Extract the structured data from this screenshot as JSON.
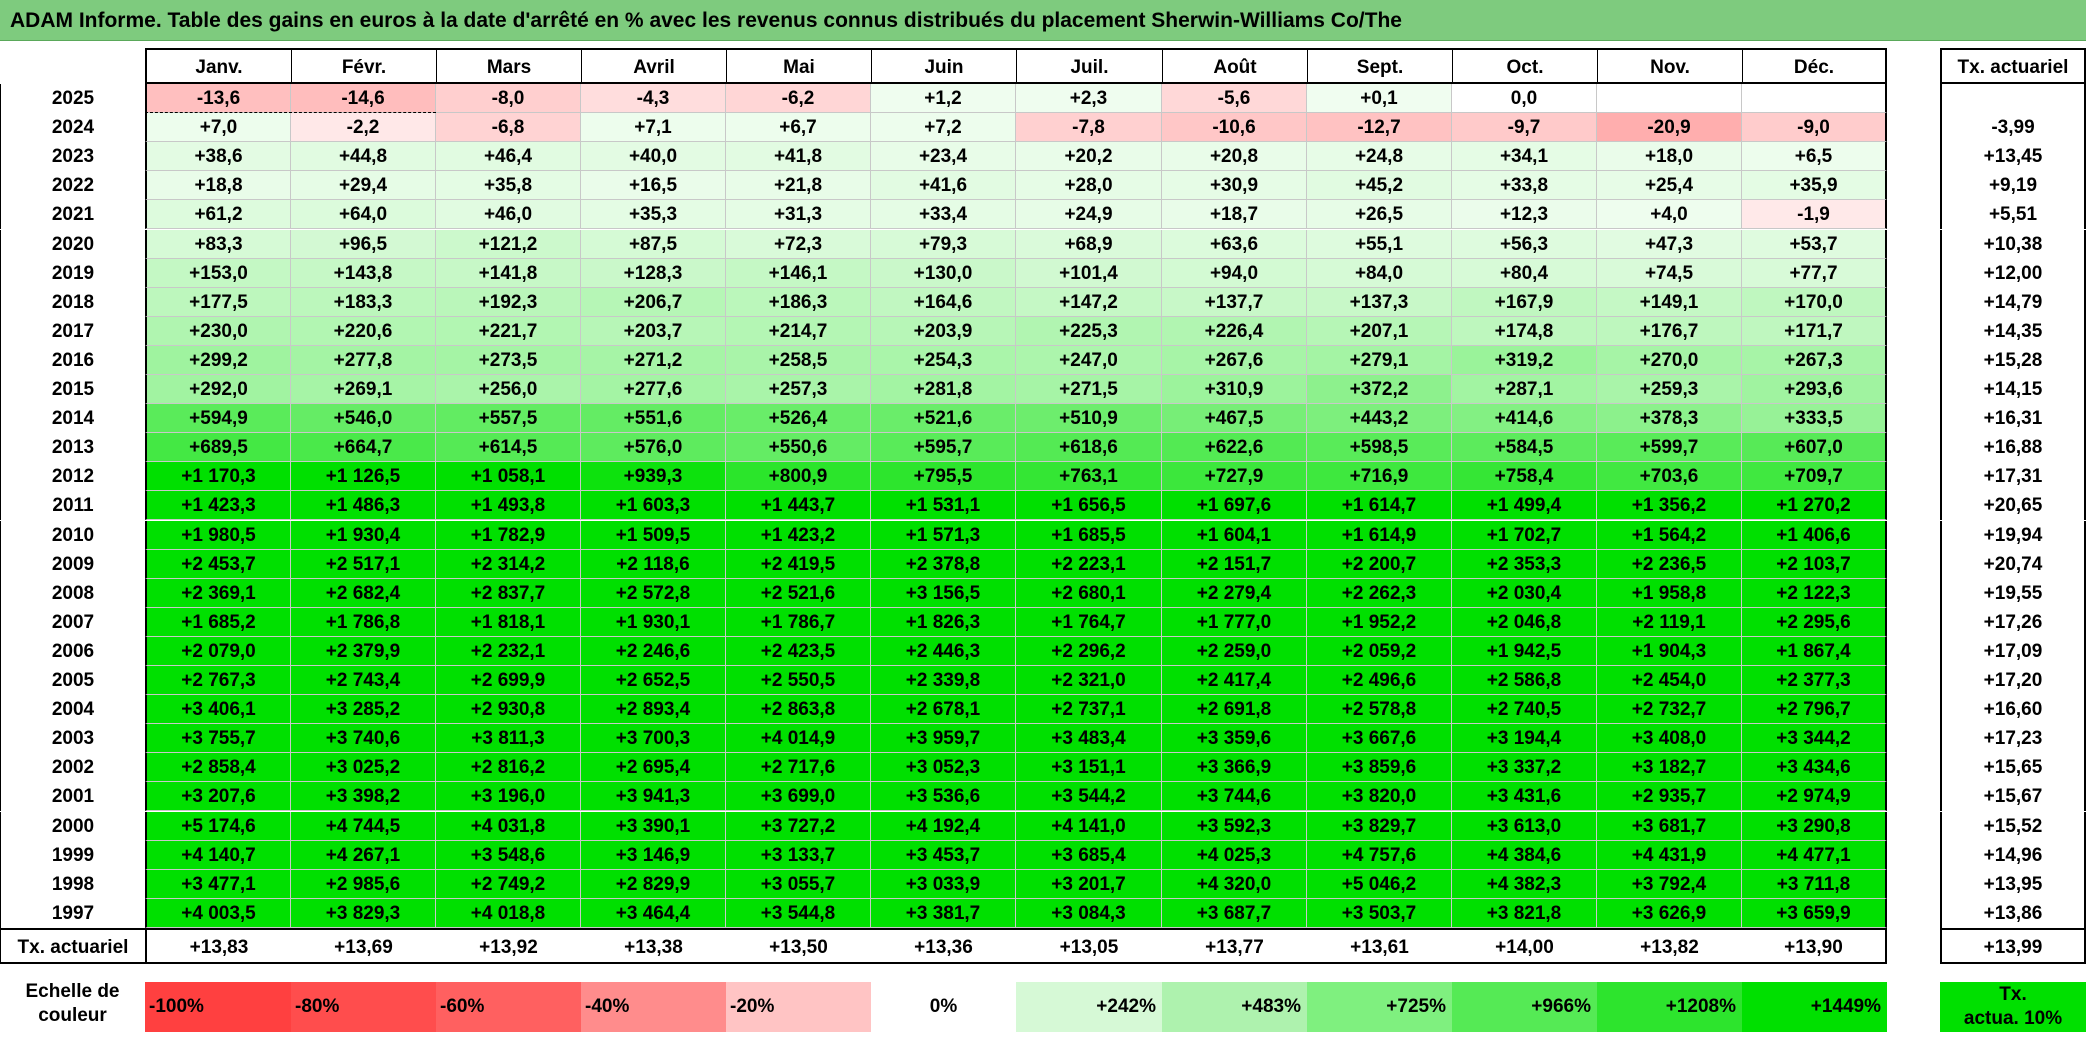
{
  "title": "ADAM Informe. Table des gains en euros à la date d'arrêté en % avec les revenus connus distribués du placement Sherwin-Williams Co/The",
  "colors": {
    "title_bg": "#7ecb7e",
    "negative_base": "#ff4040",
    "positive_base": "#00e000"
  },
  "table": {
    "months": [
      "Janv.",
      "Févr.",
      "Mars",
      "Avril",
      "Mai",
      "Juin",
      "Juil.",
      "Août",
      "Sept.",
      "Oct.",
      "Nov.",
      "Déc."
    ],
    "rate_header": "Tx. actuariel",
    "rows": [
      {
        "year": "2025",
        "values": [
          "-13,6",
          "-14,6",
          "-8,0",
          "-4,3",
          "-6,2",
          "+1,2",
          "+2,3",
          "-5,6",
          "+0,1",
          "0,0",
          "",
          ""
        ],
        "rate": ""
      },
      {
        "year": "2024",
        "values": [
          "+7,0",
          "-2,2",
          "-6,8",
          "+7,1",
          "+6,7",
          "+7,2",
          "-7,8",
          "-10,6",
          "-12,7",
          "-9,7",
          "-20,9",
          "-9,0"
        ],
        "rate": "-3,99"
      },
      {
        "year": "2023",
        "values": [
          "+38,6",
          "+44,8",
          "+46,4",
          "+40,0",
          "+41,8",
          "+23,4",
          "+20,2",
          "+20,8",
          "+24,8",
          "+34,1",
          "+18,0",
          "+6,5"
        ],
        "rate": "+13,45"
      },
      {
        "year": "2022",
        "values": [
          "+18,8",
          "+29,4",
          "+35,8",
          "+16,5",
          "+21,8",
          "+41,6",
          "+28,0",
          "+30,9",
          "+45,2",
          "+33,8",
          "+25,4",
          "+35,9"
        ],
        "rate": "+9,19"
      },
      {
        "year": "2021",
        "values": [
          "+61,2",
          "+64,0",
          "+46,0",
          "+35,3",
          "+31,3",
          "+33,4",
          "+24,9",
          "+18,7",
          "+26,5",
          "+12,3",
          "+4,0",
          "-1,9"
        ],
        "rate": "+5,51"
      },
      {
        "year": "2020",
        "values": [
          "+83,3",
          "+96,5",
          "+121,2",
          "+87,5",
          "+72,3",
          "+79,3",
          "+68,9",
          "+63,6",
          "+55,1",
          "+56,3",
          "+47,3",
          "+53,7"
        ],
        "rate": "+10,38"
      },
      {
        "year": "2019",
        "values": [
          "+153,0",
          "+143,8",
          "+141,8",
          "+128,3",
          "+146,1",
          "+130,0",
          "+101,4",
          "+94,0",
          "+84,0",
          "+80,4",
          "+74,5",
          "+77,7"
        ],
        "rate": "+12,00"
      },
      {
        "year": "2018",
        "values": [
          "+177,5",
          "+183,3",
          "+192,3",
          "+206,7",
          "+186,3",
          "+164,6",
          "+147,2",
          "+137,7",
          "+137,3",
          "+167,9",
          "+149,1",
          "+170,0"
        ],
        "rate": "+14,79"
      },
      {
        "year": "2017",
        "values": [
          "+230,0",
          "+220,6",
          "+221,7",
          "+203,7",
          "+214,7",
          "+203,9",
          "+225,3",
          "+226,4",
          "+207,1",
          "+174,8",
          "+176,7",
          "+171,7"
        ],
        "rate": "+14,35"
      },
      {
        "year": "2016",
        "values": [
          "+299,2",
          "+277,8",
          "+273,5",
          "+271,2",
          "+258,5",
          "+254,3",
          "+247,0",
          "+267,6",
          "+279,1",
          "+319,2",
          "+270,0",
          "+267,3"
        ],
        "rate": "+15,28"
      },
      {
        "year": "2015",
        "values": [
          "+292,0",
          "+269,1",
          "+256,0",
          "+277,6",
          "+257,3",
          "+281,8",
          "+271,5",
          "+310,9",
          "+372,2",
          "+287,1",
          "+259,3",
          "+293,6"
        ],
        "rate": "+14,15"
      },
      {
        "year": "2014",
        "values": [
          "+594,9",
          "+546,0",
          "+557,5",
          "+551,6",
          "+526,4",
          "+521,6",
          "+510,9",
          "+467,5",
          "+443,2",
          "+414,6",
          "+378,3",
          "+333,5"
        ],
        "rate": "+16,31"
      },
      {
        "year": "2013",
        "values": [
          "+689,5",
          "+664,7",
          "+614,5",
          "+576,0",
          "+550,6",
          "+595,7",
          "+618,6",
          "+622,6",
          "+598,5",
          "+584,5",
          "+599,7",
          "+607,0"
        ],
        "rate": "+16,88"
      },
      {
        "year": "2012",
        "values": [
          "+1 170,3",
          "+1 126,5",
          "+1 058,1",
          "+939,3",
          "+800,9",
          "+795,5",
          "+763,1",
          "+727,9",
          "+716,9",
          "+758,4",
          "+703,6",
          "+709,7"
        ],
        "rate": "+17,31"
      },
      {
        "year": "2011",
        "values": [
          "+1 423,3",
          "+1 486,3",
          "+1 493,8",
          "+1 603,3",
          "+1 443,7",
          "+1 531,1",
          "+1 656,5",
          "+1 697,6",
          "+1 614,7",
          "+1 499,4",
          "+1 356,2",
          "+1 270,2"
        ],
        "rate": "+20,65"
      },
      {
        "year": "2010",
        "values": [
          "+1 980,5",
          "+1 930,4",
          "+1 782,9",
          "+1 509,5",
          "+1 423,2",
          "+1 571,3",
          "+1 685,5",
          "+1 604,1",
          "+1 614,9",
          "+1 702,7",
          "+1 564,2",
          "+1 406,6"
        ],
        "rate": "+19,94"
      },
      {
        "year": "2009",
        "values": [
          "+2 453,7",
          "+2 517,1",
          "+2 314,2",
          "+2 118,6",
          "+2 419,5",
          "+2 378,8",
          "+2 223,1",
          "+2 151,7",
          "+2 200,7",
          "+2 353,3",
          "+2 236,5",
          "+2 103,7"
        ],
        "rate": "+20,74"
      },
      {
        "year": "2008",
        "values": [
          "+2 369,1",
          "+2 682,4",
          "+2 837,7",
          "+2 572,8",
          "+2 521,6",
          "+3 156,5",
          "+2 680,1",
          "+2 279,4",
          "+2 262,3",
          "+2 030,4",
          "+1 958,8",
          "+2 122,3"
        ],
        "rate": "+19,55"
      },
      {
        "year": "2007",
        "values": [
          "+1 685,2",
          "+1 786,8",
          "+1 818,1",
          "+1 930,1",
          "+1 786,7",
          "+1 826,3",
          "+1 764,7",
          "+1 777,0",
          "+1 952,2",
          "+2 046,8",
          "+2 119,1",
          "+2 295,6"
        ],
        "rate": "+17,26"
      },
      {
        "year": "2006",
        "values": [
          "+2 079,0",
          "+2 379,9",
          "+2 232,1",
          "+2 246,6",
          "+2 423,5",
          "+2 446,3",
          "+2 296,2",
          "+2 259,0",
          "+2 059,2",
          "+1 942,5",
          "+1 904,3",
          "+1 867,4"
        ],
        "rate": "+17,09"
      },
      {
        "year": "2005",
        "values": [
          "+2 767,3",
          "+2 743,4",
          "+2 699,9",
          "+2 652,5",
          "+2 550,5",
          "+2 339,8",
          "+2 321,0",
          "+2 417,4",
          "+2 496,6",
          "+2 586,8",
          "+2 454,0",
          "+2 377,3"
        ],
        "rate": "+17,20"
      },
      {
        "year": "2004",
        "values": [
          "+3 406,1",
          "+3 285,2",
          "+2 930,8",
          "+2 893,4",
          "+2 863,8",
          "+2 678,1",
          "+2 737,1",
          "+2 691,8",
          "+2 578,8",
          "+2 740,5",
          "+2 732,7",
          "+2 796,7"
        ],
        "rate": "+16,60"
      },
      {
        "year": "2003",
        "values": [
          "+3 755,7",
          "+3 740,6",
          "+3 811,3",
          "+3 700,3",
          "+4 014,9",
          "+3 959,7",
          "+3 483,4",
          "+3 359,6",
          "+3 667,6",
          "+3 194,4",
          "+3 408,0",
          "+3 344,2"
        ],
        "rate": "+17,23"
      },
      {
        "year": "2002",
        "values": [
          "+2 858,4",
          "+3 025,2",
          "+2 816,2",
          "+2 695,4",
          "+2 717,6",
          "+3 052,3",
          "+3 151,1",
          "+3 366,9",
          "+3 859,6",
          "+3 337,2",
          "+3 182,7",
          "+3 434,6"
        ],
        "rate": "+15,65"
      },
      {
        "year": "2001",
        "values": [
          "+3 207,6",
          "+3 398,2",
          "+3 196,0",
          "+3 941,3",
          "+3 699,0",
          "+3 536,6",
          "+3 544,2",
          "+3 744,6",
          "+3 820,0",
          "+3 431,6",
          "+2 935,7",
          "+2 974,9"
        ],
        "rate": "+15,67"
      },
      {
        "year": "2000",
        "values": [
          "+5 174,6",
          "+4 744,5",
          "+4 031,8",
          "+3 390,1",
          "+3 727,2",
          "+4 192,4",
          "+4 141,0",
          "+3 592,3",
          "+3 829,7",
          "+3 613,0",
          "+3 681,7",
          "+3 290,8"
        ],
        "rate": "+15,52"
      },
      {
        "year": "1999",
        "values": [
          "+4 140,7",
          "+4 267,1",
          "+3 548,6",
          "+3 146,9",
          "+3 133,7",
          "+3 453,7",
          "+3 685,4",
          "+4 025,3",
          "+4 757,6",
          "+4 384,6",
          "+4 431,9",
          "+4 477,1"
        ],
        "rate": "+14,96"
      },
      {
        "year": "1998",
        "values": [
          "+3 477,1",
          "+2 985,6",
          "+2 749,2",
          "+2 829,9",
          "+3 055,7",
          "+3 033,9",
          "+3 201,7",
          "+4 320,0",
          "+5 046,2",
          "+4 382,3",
          "+3 792,4",
          "+3 711,8"
        ],
        "rate": "+13,95"
      },
      {
        "year": "1997",
        "values": [
          "+4 003,5",
          "+3 829,3",
          "+4 018,8",
          "+3 464,4",
          "+3 544,8",
          "+3 381,7",
          "+3 084,3",
          "+3 687,7",
          "+3 503,7",
          "+3 821,8",
          "+3 626,9",
          "+3 659,9"
        ],
        "rate": "+13,86"
      }
    ],
    "footer": {
      "label": "Tx. actuariel",
      "values": [
        "+13,83",
        "+13,69",
        "+13,92",
        "+13,38",
        "+13,50",
        "+13,36",
        "+13,05",
        "+13,77",
        "+13,61",
        "+14,00",
        "+13,82",
        "+13,90"
      ],
      "rate": "+13,99"
    }
  },
  "scale": {
    "label_line1": "Echelle de",
    "label_line2": "couleur",
    "items": [
      {
        "label": "-100%",
        "color": "#ff4040"
      },
      {
        "label": "-80%",
        "color": "#ff4d4d"
      },
      {
        "label": "-60%",
        "color": "#ff6060"
      },
      {
        "label": "-40%",
        "color": "#ff8c8c"
      },
      {
        "label": "-20%",
        "color": "#ffc4c4"
      },
      {
        "label": "0%",
        "color": "#ffffff"
      },
      {
        "label": "+242%",
        "color": "#d6f9d6"
      },
      {
        "label": "+483%",
        "color": "#aef2ae"
      },
      {
        "label": "+725%",
        "color": "#7ff07f"
      },
      {
        "label": "+966%",
        "color": "#55ea55"
      },
      {
        "label": "+1208%",
        "color": "#2de42d"
      },
      {
        "label": "+1449%",
        "color": "#00e000"
      }
    ],
    "rate_label_line1": "Tx.",
    "rate_label_line2": "actua. 10%",
    "rate_color": "#00e000"
  }
}
